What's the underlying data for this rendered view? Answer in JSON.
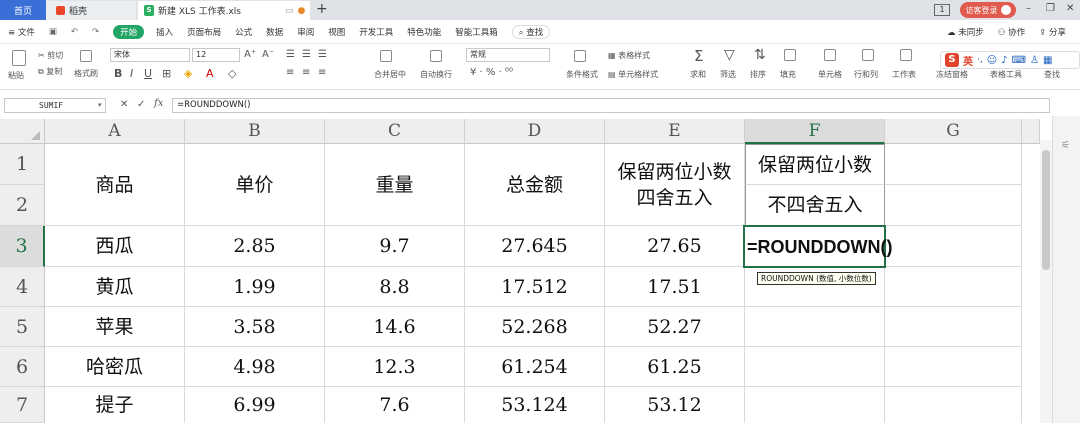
{
  "tabs": {
    "home": "首页",
    "wps": "稻壳",
    "file": "新建 XLS 工作表.xls",
    "new_tab": "+"
  },
  "titlebar": {
    "page_num": "1",
    "login": "访客登录",
    "minimize": "–",
    "restore": "❐",
    "close": "✕"
  },
  "menu": {
    "file": "≡ 文件",
    "items": [
      "开始",
      "插入",
      "页面布局",
      "公式",
      "数据",
      "审阅",
      "视图",
      "开发工具",
      "特色功能",
      "智能工具箱"
    ],
    "search": "查找",
    "sync": "未同步",
    "collab": "协作",
    "share": "分享"
  },
  "ribbon": {
    "paste": "粘贴",
    "cut": "剪切",
    "copy": "复制",
    "format_painter": "格式刷",
    "font": "宋体",
    "font_size": "12",
    "wrap": "合并居中",
    "auto_wrap": "自动换行",
    "num_format": "常规",
    "table_style": "表格样式",
    "cond_format": "条件格式",
    "cell_style": "单元格样式",
    "sum": "求和",
    "filter": "筛选",
    "sort": "排序",
    "fill": "填充",
    "cells": "单元格",
    "rowcol": "行和列",
    "sheet": "工作表",
    "freeze": "冻结窗格",
    "table_tool": "表格工具",
    "find": "查找"
  },
  "ime": {
    "label": "英"
  },
  "formula_bar": {
    "name_box": "SUMIF",
    "cancel": "✕",
    "confirm": "✓",
    "fx": "fx",
    "content": "=ROUNDDOWN()"
  },
  "columns": [
    "A",
    "B",
    "C",
    "D",
    "E",
    "F",
    "G"
  ],
  "rows": [
    "1",
    "2",
    "3",
    "4",
    "5",
    "6",
    "7"
  ],
  "header_row": {
    "a": "商品",
    "b": "单价",
    "c": "重量",
    "d": "总金额",
    "e_line1": "保留两位小数",
    "e_line2": "四舍五入",
    "f_line1": "保留两位小数",
    "f_line2": "不四舍五入"
  },
  "data_rows": [
    {
      "a": "西瓜",
      "b": "2.85",
      "c": "9.7",
      "d": "27.645",
      "e": "27.65",
      "f": "=ROUNDDOWN()"
    },
    {
      "a": "黄瓜",
      "b": "1.99",
      "c": "8.8",
      "d": "17.512",
      "e": "17.51",
      "f": ""
    },
    {
      "a": "苹果",
      "b": "3.58",
      "c": "14.6",
      "d": "52.268",
      "e": "52.27",
      "f": ""
    },
    {
      "a": "哈密瓜",
      "b": "4.98",
      "c": "12.3",
      "d": "61.254",
      "e": "61.25",
      "f": ""
    },
    {
      "a": "提子",
      "b": "6.99",
      "c": "7.6",
      "d": "53.124",
      "e": "53.12",
      "f": ""
    }
  ],
  "tooltip": "ROUNDDOWN (数值, 小数位数)",
  "colors": {
    "accent_green": "#23a566",
    "tab_blue": "#3a6fd8",
    "login_red": "#e05a4d"
  }
}
